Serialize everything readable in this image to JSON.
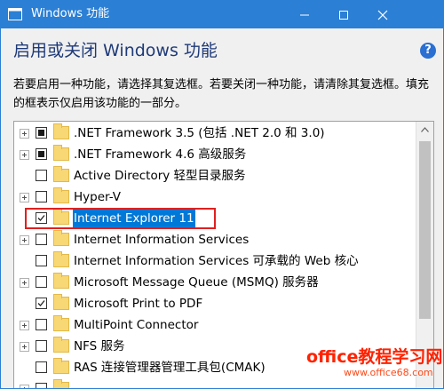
{
  "window": {
    "title": "Windows 功能",
    "accent_color": "#2b7fd4",
    "icons": [
      "app-window-icon",
      "minimize-icon",
      "maximize-icon",
      "close-icon"
    ]
  },
  "header": {
    "heading": "启用或关闭 Windows 功能",
    "help_label": "?",
    "description": "若要启用一种功能，请选择其复选框。若要关闭一种功能，请清除其复选框。填充的框表示仅启用该功能的一部分。"
  },
  "features": [
    {
      "label": ".NET Framework 3.5 (包括 .NET 2.0 和 3.0)",
      "expandable": true,
      "state": "partial",
      "selected": false
    },
    {
      "label": ".NET Framework 4.6 高级服务",
      "expandable": true,
      "state": "partial",
      "selected": false
    },
    {
      "label": "Active Directory 轻型目录服务",
      "expandable": false,
      "state": "unchecked",
      "selected": false
    },
    {
      "label": "Hyper-V",
      "expandable": true,
      "state": "unchecked",
      "selected": false
    },
    {
      "label": "Internet Explorer 11",
      "expandable": false,
      "state": "checked",
      "selected": true
    },
    {
      "label": "Internet Information Services",
      "expandable": true,
      "state": "unchecked",
      "selected": false
    },
    {
      "label": "Internet Information Services 可承载的 Web 核心",
      "expandable": false,
      "state": "unchecked",
      "selected": false
    },
    {
      "label": "Microsoft Message Queue (MSMQ) 服务器",
      "expandable": true,
      "state": "unchecked",
      "selected": false
    },
    {
      "label": "Microsoft Print to PDF",
      "expandable": false,
      "state": "checked",
      "selected": false
    },
    {
      "label": "MultiPoint Connector",
      "expandable": true,
      "state": "unchecked",
      "selected": false
    },
    {
      "label": "NFS 服务",
      "expandable": true,
      "state": "unchecked",
      "selected": false
    },
    {
      "label": "RAS 连接管理器管理工具包(CMAK)",
      "expandable": false,
      "state": "unchecked",
      "selected": false
    }
  ],
  "watermark": {
    "main": "office教程学习网",
    "url": "www.office68.com"
  },
  "colors": {
    "selection": "#0078d7",
    "highlight_box": "#e02020",
    "folder": "#f8d775",
    "watermark": "#ff2200"
  }
}
